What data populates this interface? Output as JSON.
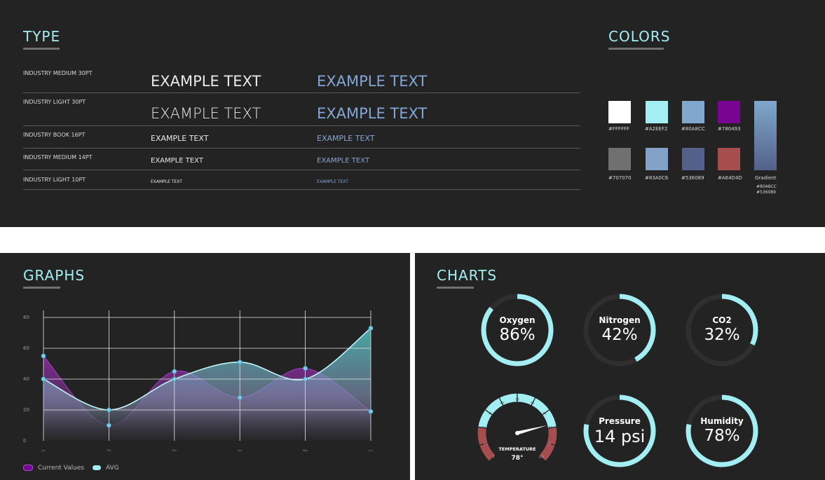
{
  "type_section": {
    "title": "TYPE",
    "rows": [
      {
        "label": "INDUSTRY MEDIUM 30PT",
        "sample": "EXAMPLE TEXT"
      },
      {
        "label": "INDUSTRY LIGHT 30PT",
        "sample": "EXAMPLE TEXT"
      },
      {
        "label": "INDUSTRY BOOK 16PT",
        "sample": "EXAMPLE TEXT"
      },
      {
        "label": "INDUSTRY MEDIUM 14PT",
        "sample": "EXAMPLE TEXT"
      },
      {
        "label": "INDUSTRY LIGHT 10PT",
        "sample": "EXAMPLE TEXT"
      }
    ]
  },
  "colors_section": {
    "title": "COLORS",
    "swatches": [
      {
        "hex": "#FFFFFF",
        "label": "#FFFFFF"
      },
      {
        "hex": "#A2EEF2",
        "label": "#A2EEF2"
      },
      {
        "hex": "#80A8CC",
        "label": "#80A8CC"
      },
      {
        "hex": "#780493",
        "label": "#780493"
      },
      {
        "hex": "#707070",
        "label": "#707070"
      },
      {
        "hex": "#83A0C6",
        "label": "#83A0C6"
      },
      {
        "hex": "#536089",
        "label": "#536089"
      },
      {
        "hex": "#A64D4D",
        "label": "#A64D4D"
      }
    ],
    "gradient": {
      "label": "Gradient",
      "stop1": "#80A8CC",
      "stop2": "#536089"
    }
  },
  "graphs_section": {
    "title": "GRAPHS",
    "legend": [
      {
        "name": "Current Values",
        "color": "#780493"
      },
      {
        "name": "AVG",
        "color": "#A2EEF2"
      }
    ]
  },
  "chart_data": {
    "type": "area",
    "x": [
      "Jan",
      "Feb",
      "Mar",
      "Apr",
      "May",
      "Jun"
    ],
    "ylim": [
      0,
      80
    ],
    "yticks": [
      "0",
      "20",
      "40",
      "60",
      "80"
    ],
    "grid": true,
    "legend_position": "bottom-left",
    "series": [
      {
        "name": "Current Values",
        "color": "#780493",
        "values": [
          55,
          10,
          45,
          28,
          47,
          19
        ]
      },
      {
        "name": "AVG",
        "color": "#A2EEF2",
        "values": [
          40,
          20,
          40,
          51,
          40,
          73
        ]
      }
    ]
  },
  "charts_section": {
    "title": "CHARTS",
    "donuts": [
      {
        "name": "Oxygen",
        "value": "86%",
        "fraction": 0.86
      },
      {
        "name": "Nitrogen",
        "value": "42%",
        "fraction": 0.42
      },
      {
        "name": "CO2",
        "value": "32%",
        "fraction": 0.32
      },
      {
        "name": "Pressure",
        "value": "14 psi",
        "fraction": 0.78
      },
      {
        "name": "Humidity",
        "value": "78%",
        "fraction": 0.78
      }
    ],
    "gauge": {
      "label": "TEMPERATURE",
      "value_text": "78°",
      "value": 78,
      "min": 0,
      "max": 100,
      "ticks": [
        "0",
        "10",
        "20",
        "30",
        "40",
        "50",
        "60",
        "70",
        "80",
        "90",
        "100"
      ],
      "normal_color": "#A2EEF2",
      "alert_color": "#A64D4D"
    }
  }
}
